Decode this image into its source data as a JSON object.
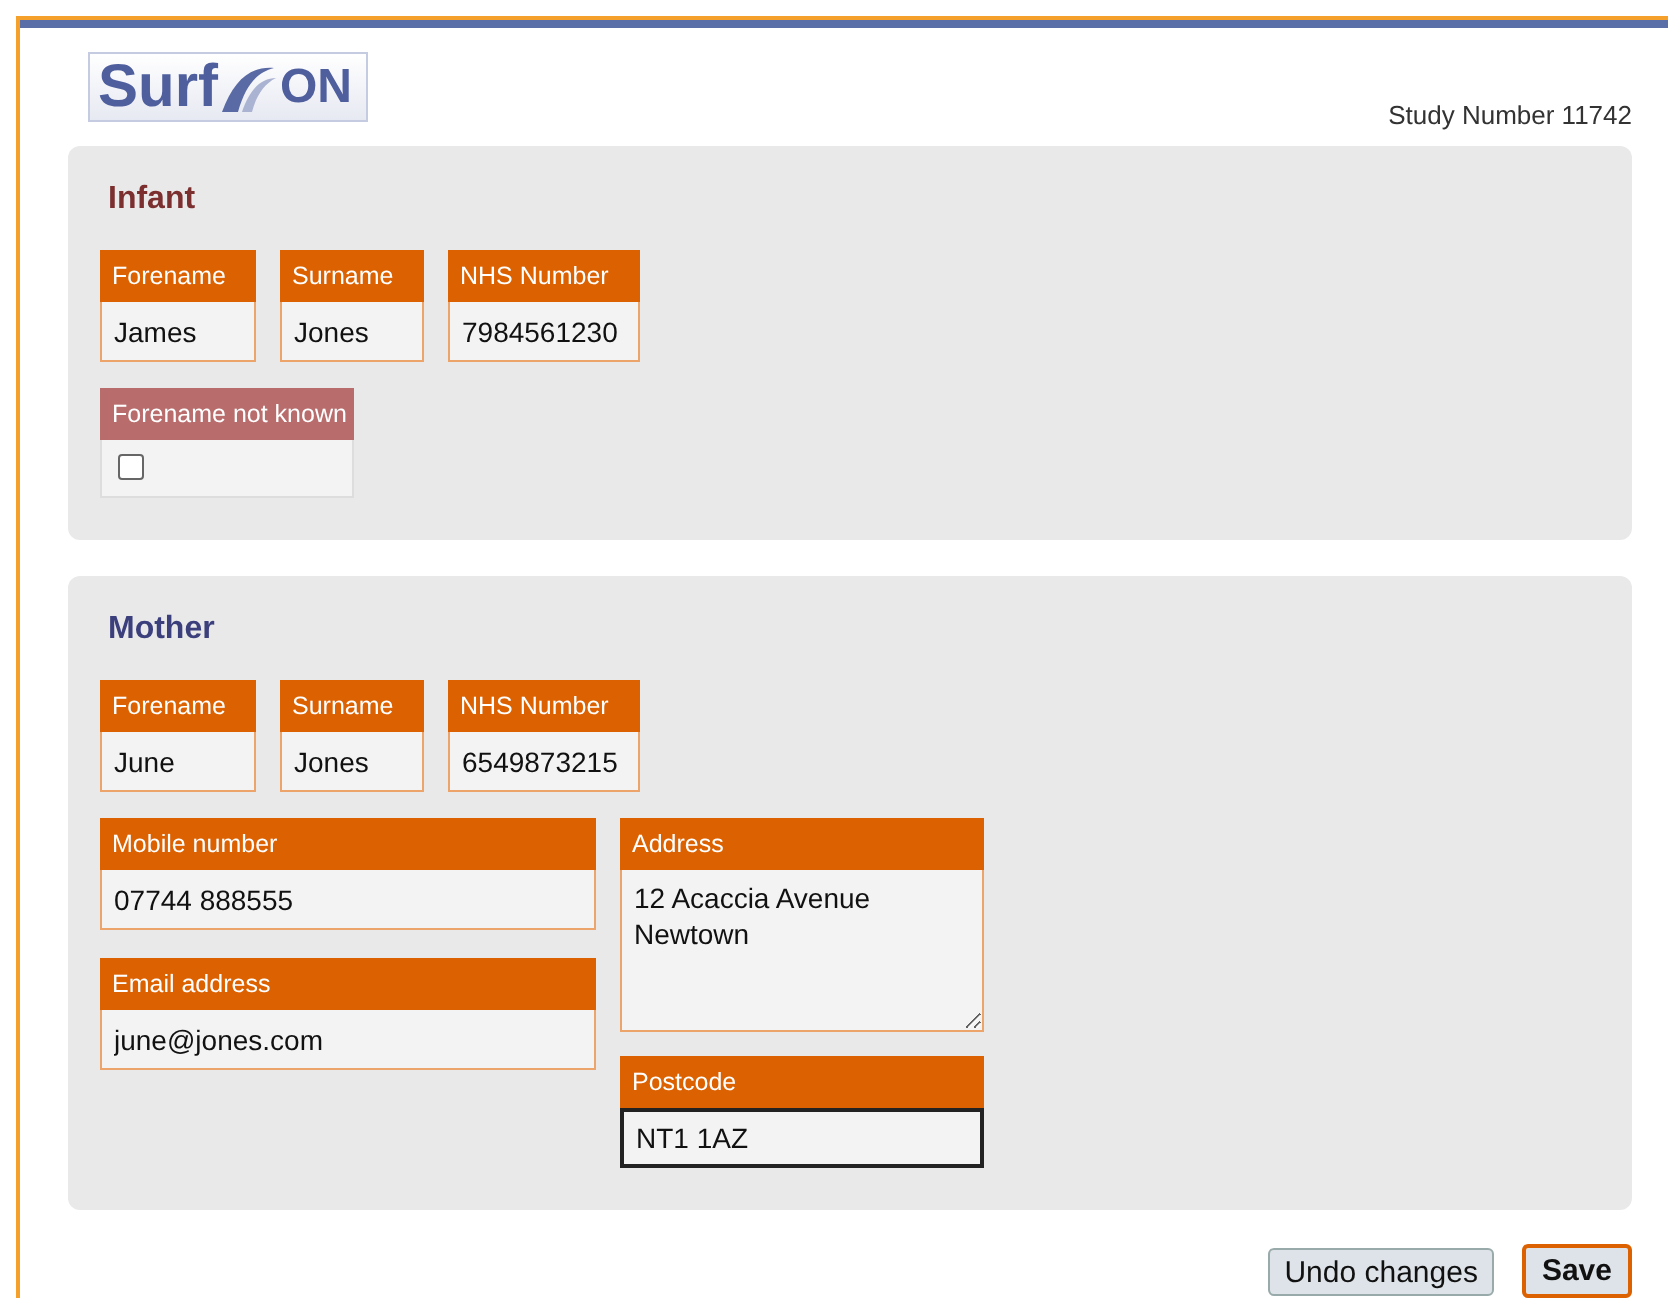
{
  "logo": {
    "left": "Surf",
    "right": "ON"
  },
  "study_number": "Study Number 11742",
  "sections": [
    {
      "kind": "infant",
      "title": "Infant",
      "color": "#7b2f2f",
      "fields": [
        {
          "label": "Forename",
          "value": "James"
        },
        {
          "label": "Surname",
          "value": "Jones"
        },
        {
          "label": "NHS Number",
          "value": "7984561230"
        }
      ],
      "forename_not_known": {
        "label": "Forename not known",
        "checked": false
      }
    },
    {
      "kind": "mother",
      "title": "Mother",
      "color": "#3b3f7c",
      "fields": [
        {
          "label": "Forename",
          "value": "June"
        },
        {
          "label": "Surname",
          "value": "Jones"
        },
        {
          "label": "NHS Number",
          "value": "6549873215"
        }
      ],
      "contact": [
        {
          "label": "Mobile number",
          "value": "07744 888555"
        },
        {
          "label": "Email address",
          "value": "june@jones.com"
        }
      ],
      "address": {
        "label": "Address",
        "lines": [
          "12 Acaccia Avenue",
          "Newtown"
        ]
      },
      "postcode": {
        "label": "Postcode",
        "value": "NT1 1AZ",
        "focused": true
      }
    }
  ],
  "buttons": [
    {
      "label": "Undo changes",
      "kind": "secondary"
    },
    {
      "label": "Save",
      "kind": "primary"
    }
  ]
}
